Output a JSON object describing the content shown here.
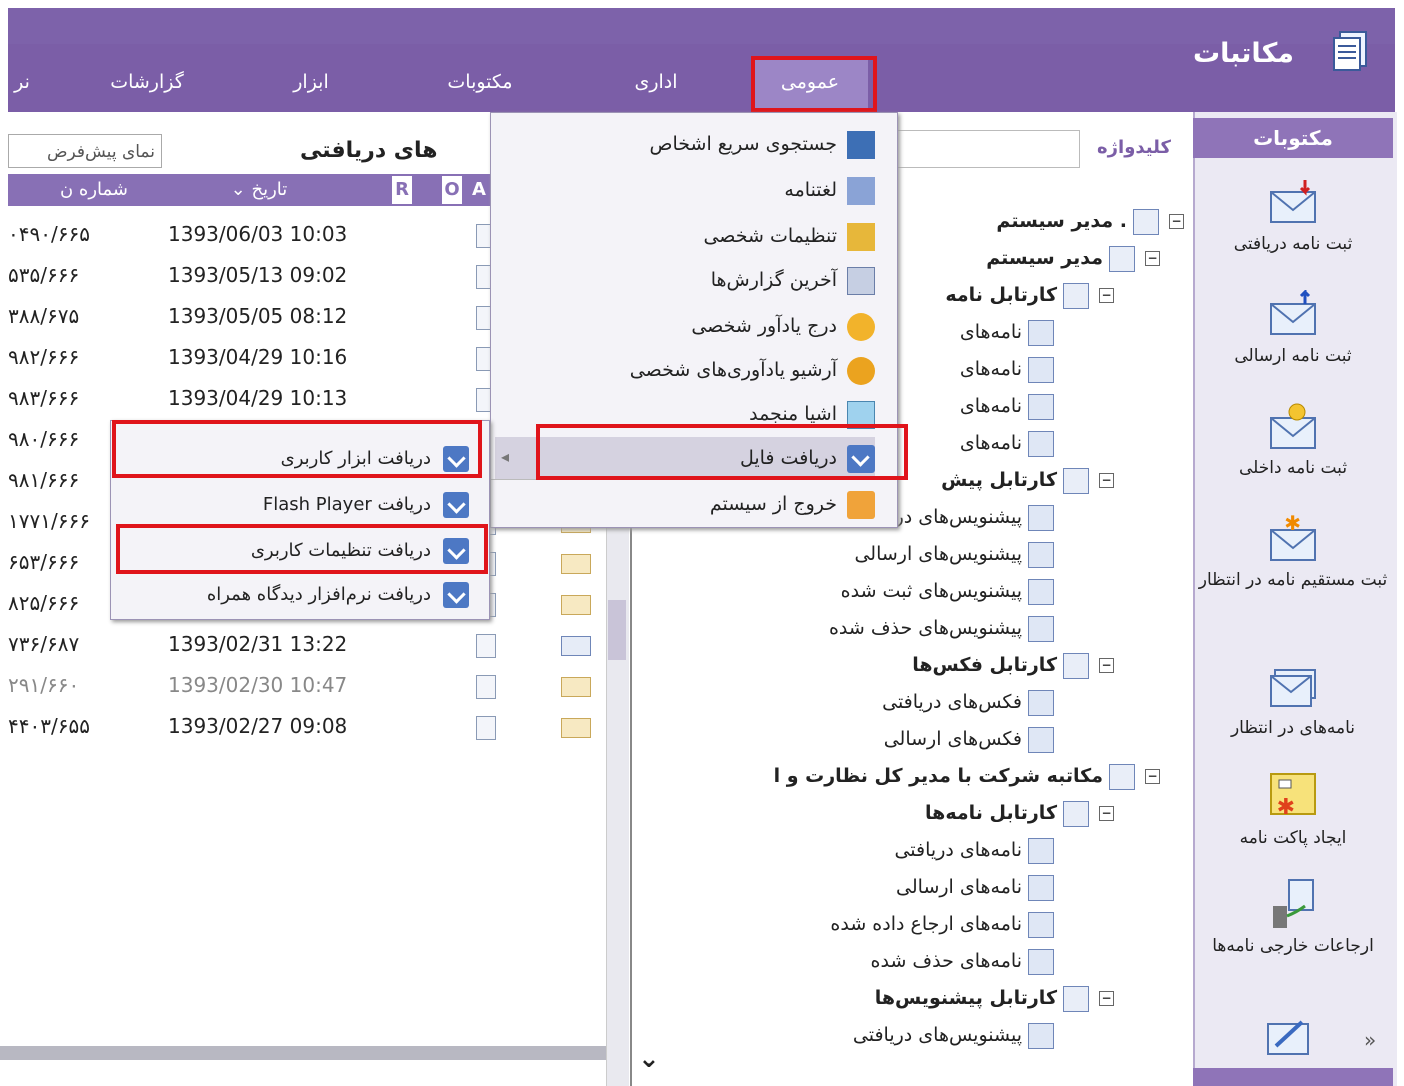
{
  "app": {
    "title": "مکاتبات"
  },
  "tabs": [
    "عمومی",
    "اداری",
    "مکتوبات",
    "ابزار",
    "گزارشات",
    "نر"
  ],
  "sidebar": {
    "header": "مکتوبات",
    "items": [
      "ثبت نامه دریافتی",
      "ثبت نامه ارسالی",
      "ثبت نامه داخلی",
      "ثبت مستقیم نامه در انتظار",
      "نامه‌های در انتظار",
      "ایجاد پاکت نامه",
      "ارجاعات خارجی نامه‌ها"
    ]
  },
  "keyword": {
    "label": "کلیدواژه"
  },
  "tree": [
    {
      "label": ". مدیر سیستم",
      "bold": true
    },
    {
      "label": "مدیر سیستم",
      "bold": true
    },
    {
      "label": "کارتابل نامه",
      "bold": true
    },
    {
      "label": "نامه‌های",
      "bold": false
    },
    {
      "label": "نامه‌های",
      "bold": false
    },
    {
      "label": "نامه‌های",
      "bold": false
    },
    {
      "label": "نامه‌های",
      "bold": false
    },
    {
      "label": "کارتابل پیش",
      "bold": true
    },
    {
      "label": "پیشنویس‌های دریافتی",
      "bold": false
    },
    {
      "label": "پیشنویس‌های ارسالی",
      "bold": false
    },
    {
      "label": "پیشنویس‌های ثبت شده",
      "bold": false
    },
    {
      "label": "پیشنویس‌های حذف شده",
      "bold": false
    },
    {
      "label": "کارتابل فکس‌ها",
      "bold": true
    },
    {
      "label": "فکس‌های دریافتی",
      "bold": false
    },
    {
      "label": "فکس‌های ارسالی",
      "bold": false
    },
    {
      "label": "مکاتبه شرکت با مدیر کل نظارت و ا",
      "bold": true
    },
    {
      "label": "کارتابل نامه‌ها",
      "bold": true
    },
    {
      "label": "نامه‌های دریافتی",
      "bold": false
    },
    {
      "label": "نامه‌های ارسالی",
      "bold": false
    },
    {
      "label": "نامه‌های ارجاع داده شده",
      "bold": false
    },
    {
      "label": "نامه‌های حذف شده",
      "bold": false
    },
    {
      "label": "کارتابل پیشنویس‌ها",
      "bold": true
    },
    {
      "label": "پیشنویس‌های دریافتی",
      "bold": false
    }
  ],
  "list": {
    "title": "‌های دریافتی",
    "view": "نمای پیش‌فرض",
    "columns": {
      "number": "شماره ن",
      "date": "تاریخ",
      "r": "R",
      "o": "O",
      "a": "A"
    },
    "rows": [
      {
        "number": "۰۴۹۰/۶۶۵",
        "date": "1393/06/03 10:03"
      },
      {
        "number": "۵۳۵/۶۶۶",
        "date": "1393/05/13 09:02"
      },
      {
        "number": "۳۸۸/۶۷۵",
        "date": "1393/05/05 08:12"
      },
      {
        "number": "۹۸۲/۶۶۶",
        "date": "1393/04/29 10:16"
      },
      {
        "number": "۹۸۳/۶۶۶",
        "date": "1393/04/29 10:13"
      },
      {
        "number": "۹۸۰/۶۶۶",
        "date": ""
      },
      {
        "number": "۹۸۱/۶۶۶",
        "date": ""
      },
      {
        "number": "۱۷۷۱/۶۶۶",
        "date": ""
      },
      {
        "number": "۶۵۳/۶۶۶",
        "date": ""
      },
      {
        "number": "۸۲۵/۶۶۶",
        "date": ""
      },
      {
        "number": "۷۳۶/۶۸۷",
        "date": "1393/02/31 13:22"
      },
      {
        "number": "۲۹۱/۶۶۰",
        "date": "1393/02/30 10:47"
      },
      {
        "number": "۴۴۰۳/۶۵۵",
        "date": "1393/02/27 09:08"
      }
    ]
  },
  "menu": {
    "items": [
      "جستجوی سریع اشخاص",
      "لغتنامه",
      "تنظیمات شخصی",
      "آخرین گزارش‌ها",
      "درج یادآور شخصی",
      "آرشیو یادآوری‌های شخصی",
      "اشیا منجمد",
      "دریافت فایل",
      "خروج از سیستم"
    ]
  },
  "submenu": {
    "items": [
      "دریافت ابزار کاربری",
      "دریافت Flash Player",
      "دریافت تنظیمات کاربری",
      "دریافت نرم‌افزار دیدگاه همراه"
    ]
  }
}
